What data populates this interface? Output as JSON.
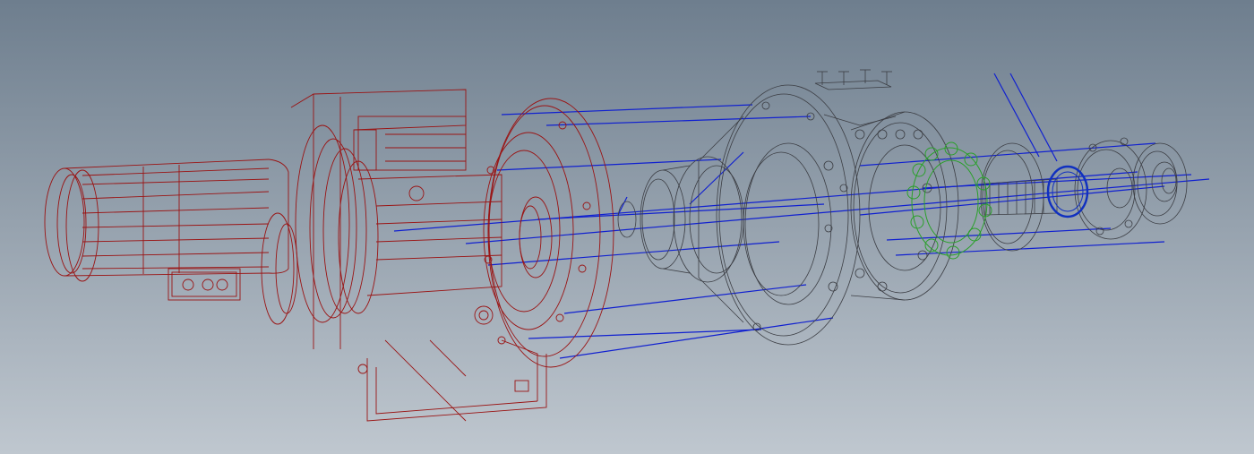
{
  "viewport": {
    "background_top": "#6e7e8e",
    "background_bottom": "#bfc7cf"
  },
  "colors": {
    "motor_gearbox": "#9a1414",
    "mixer_parts": "#3c3e44",
    "explode_lines": "#1020d0",
    "coupling_insert": "#2aa02a",
    "retaining_ring": "#1030c0"
  },
  "assembly": {
    "components": [
      "electric-motor",
      "motor-terminal-box",
      "gearbox-housing",
      "gearbox-output-flange",
      "bolts",
      "coupling-hub",
      "adapter-lantern",
      "bearing-housing",
      "elastomer-coupling-insert",
      "splined-shaft",
      "retaining-ring",
      "seal-bushing",
      "shaft-end-cap"
    ]
  }
}
